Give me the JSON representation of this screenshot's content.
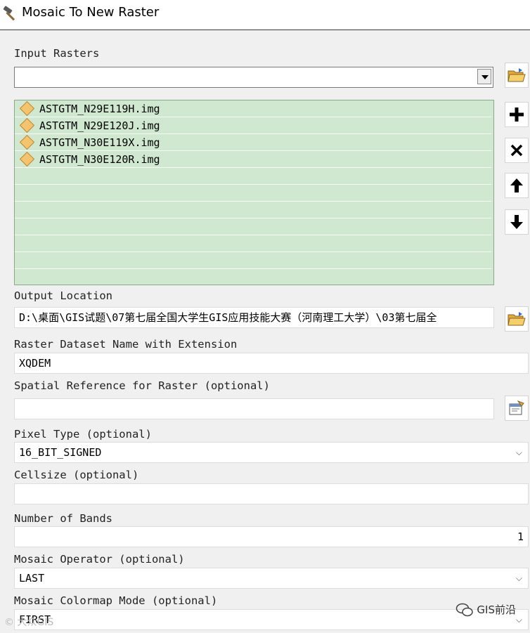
{
  "window": {
    "title": "Mosaic To New Raster"
  },
  "input_rasters": {
    "label": "Input Rasters",
    "combo_value": "",
    "items": [
      "ASTGTM_N29E119H.img",
      "ASTGTM_N29E120J.img",
      "ASTGTM_N30E119X.img",
      "ASTGTM_N30E120R.img",
      "",
      "",
      "",
      "",
      "",
      "",
      ""
    ]
  },
  "output_location": {
    "label": "Output Location",
    "value": "D:\\桌面\\GIS试题\\07第七届全国大学生GIS应用技能大赛（河南理工大学）\\03第七届全"
  },
  "raster_name": {
    "label": "Raster Dataset Name with Extension",
    "value": "XQDEM"
  },
  "spatial_reference": {
    "label": "Spatial Reference for Raster (optional)",
    "value": ""
  },
  "pixel_type": {
    "label": "Pixel Type (optional)",
    "value": "16_BIT_SIGNED"
  },
  "cellsize": {
    "label": "Cellsize (optional)",
    "value": ""
  },
  "number_of_bands": {
    "label": "Number of Bands",
    "value": "1"
  },
  "mosaic_operator": {
    "label": "Mosaic Operator (optional)",
    "value": "LAST"
  },
  "colormap_mode": {
    "label": "Mosaic Colormap Mode (optional)",
    "value": "FIRST"
  },
  "watermark": {
    "text": "GIS前沿",
    "secondary": "© 大众GIS"
  },
  "icons": {
    "title": "hammer-icon",
    "browse": "open-folder-icon",
    "add": "plus-icon",
    "remove": "x-icon",
    "up": "arrow-up-icon",
    "down": "arrow-down-icon",
    "spatial_ref": "properties-icon"
  }
}
